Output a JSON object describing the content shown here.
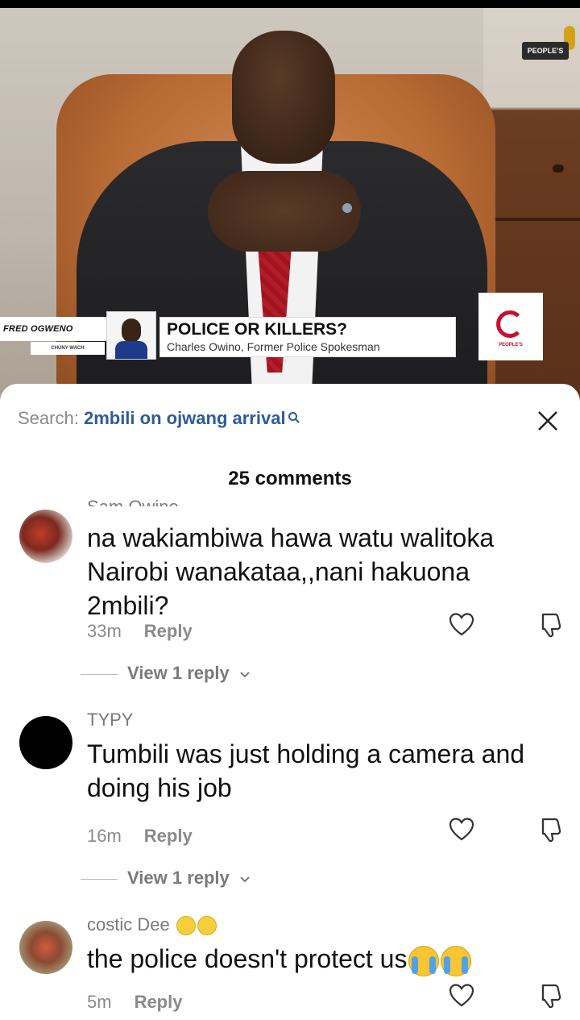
{
  "video": {
    "channel_logo": "PEOPLE'S",
    "anchor_name": "FRED OGWENO",
    "anchor_sub": "CHUNY WACH",
    "headline": "POLICE OR KILLERS?",
    "caption": "Charles Owino, Former Police Spokesman",
    "badge_text": "PEOPLE'S"
  },
  "sheet": {
    "search_prefix": "Search:",
    "search_term": "2mbili on ojwang arrival",
    "comment_count": "25 comments",
    "icons": {
      "search": "search-icon",
      "close": "close-icon",
      "like": "heart-icon",
      "dislike": "thumbs-down-icon"
    }
  },
  "comments": [
    {
      "username": "Sam Owino",
      "text": "na wakiambiwa hawa watu walitoka Nairobi wanakataa,,nani hakuona 2mbili?",
      "time": "33m",
      "reply_label": "Reply",
      "view_replies": "View 1 reply"
    },
    {
      "username": "TYPY",
      "text": "Tumbili was just holding a camera and doing his job",
      "time": "16m",
      "reply_label": "Reply",
      "view_replies": "View 1 reply"
    },
    {
      "username": "costic Dee",
      "text": "the police doesn't protect us",
      "time": "5m",
      "reply_label": "Reply"
    }
  ],
  "colors": {
    "search_term": "#2e5a9e",
    "muted": "#8a8a8a",
    "text": "#111111"
  }
}
